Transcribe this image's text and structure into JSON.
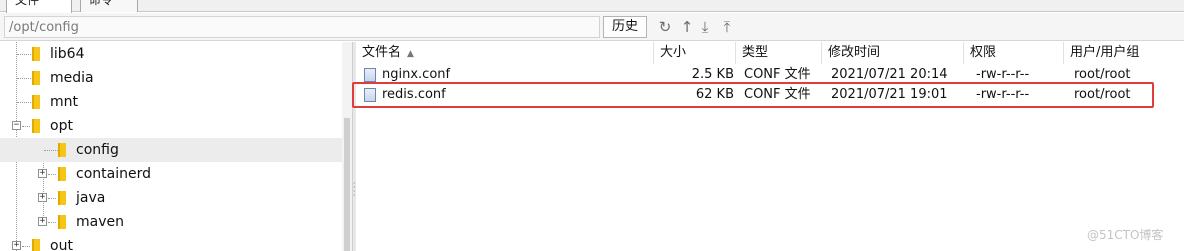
{
  "tabs": [
    "文件",
    "命令"
  ],
  "path": {
    "value": "/opt/config"
  },
  "toolbar": {
    "history_label": "历史"
  },
  "tree": {
    "items": [
      {
        "label": "lib64",
        "indent": 1
      },
      {
        "label": "media",
        "indent": 1
      },
      {
        "label": "mnt",
        "indent": 1
      },
      {
        "label": "opt",
        "indent": 0
      },
      {
        "label": "config",
        "indent": 2
      },
      {
        "label": "containerd",
        "indent": 2
      },
      {
        "label": "java",
        "indent": 2
      },
      {
        "label": "maven",
        "indent": 2
      },
      {
        "label": "out",
        "indent": 0
      }
    ]
  },
  "files": {
    "columns": [
      "文件名",
      "大小",
      "类型",
      "修改时间",
      "权限",
      "用户/用户组"
    ],
    "rows": [
      {
        "name": "nginx.conf",
        "size": "2.5 KB",
        "type": "CONF 文件",
        "modified": "2021/07/21 20:14",
        "permissions": "-rw-r--r--",
        "owner": "root/root"
      },
      {
        "name": "redis.conf",
        "size": "62 KB",
        "type": "CONF 文件",
        "modified": "2021/07/21 19:01",
        "permissions": "-rw-r--r--",
        "owner": "root/root"
      }
    ]
  },
  "watermark": "@51CTO博客",
  "colors": {
    "highlight": "#e03c3c",
    "folder": "#f5c518"
  }
}
